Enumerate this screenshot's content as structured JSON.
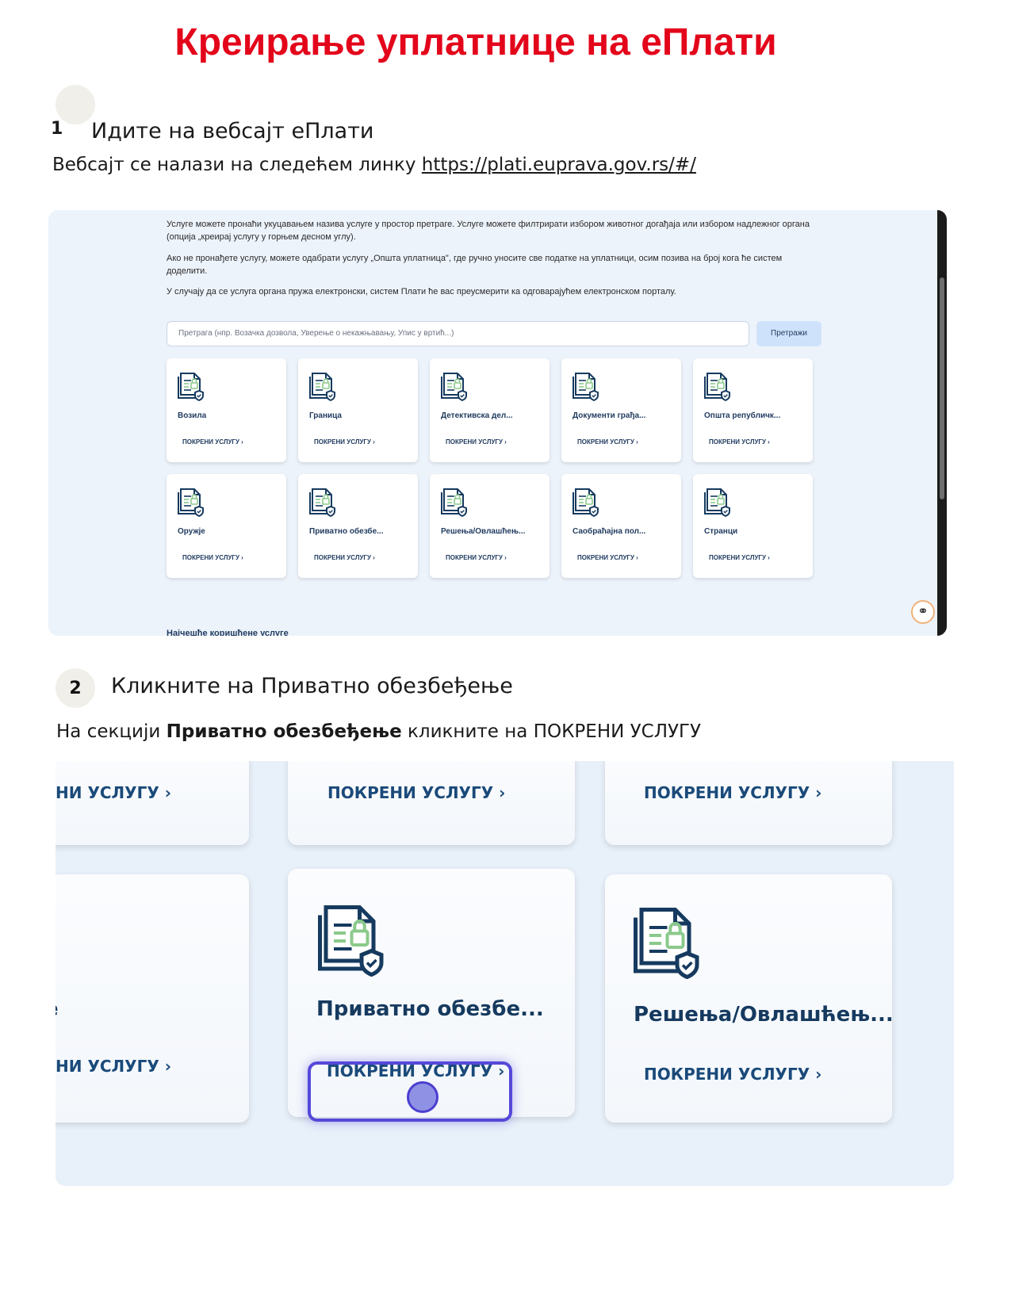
{
  "title": "Креирање уплатнице на еПлати",
  "step1": {
    "number": "1",
    "title": "Идите на вебсајт еПлати",
    "description_prefix": "Вебсајт се налази на следећем линку ",
    "link": "https://plati.euprava.gov.rs/#/"
  },
  "screenshot1": {
    "paragraph1": "Услуге можете пронаћи укуцавањем назива услуге у простор претраге. Услуге можете филтрирати избором животног догађаја или избором надлежног органа (опција „креирај услугу у горњем десном углу).",
    "paragraph2": "Ако не пронађете услугу, можете одабрати услугу „Општа уплатница\", где ручно уносите све податке на уплатници, осим позива на број кога ће систем доделити.",
    "paragraph3": "У случају да се услуга органа пружа електронски, систем Плати ће вас преусмерити ка одговарајућем електронском порталу.",
    "search_placeholder": "Претрага (нпр. Возачка дозвола, Уверење о некажњавању, Упис у вртић...)",
    "search_button": "Претражи",
    "action_label": "ПОКРЕНИ УСЛУГУ ›",
    "services": [
      "Возила",
      "Граница",
      "Детективска дел...",
      "Документи грађа...",
      "Општа републичк...",
      "Оружје",
      "Приватно обезбе...",
      "Решења/Овлашћењ...",
      "Саобраћајна пол...",
      "Странци"
    ],
    "bottom_text": "Најчешће коришћене услуге"
  },
  "step2": {
    "number": "2",
    "title": "Кликните на Приватно обезбеђење",
    "desc_prefix": "На секцији ",
    "desc_bold": "Приватно обезбеђење",
    "desc_suffix": " кликните на ПОКРЕНИ УСЛУГУ"
  },
  "screenshot2": {
    "action_label": "ПОКРЕНИ УСЛУГУ ›",
    "action_label_cut": "НИ УСЛУГУ ›",
    "card_private": "Приватно обезбе...",
    "card_decisions": "Решења/Овлашћењ...",
    "left_fragment_1": ")",
    "left_fragment_2": "е"
  },
  "colors": {
    "title_red": "#e3061b",
    "link_navy": "#1f3a5f",
    "highlight": "#5548d9"
  }
}
